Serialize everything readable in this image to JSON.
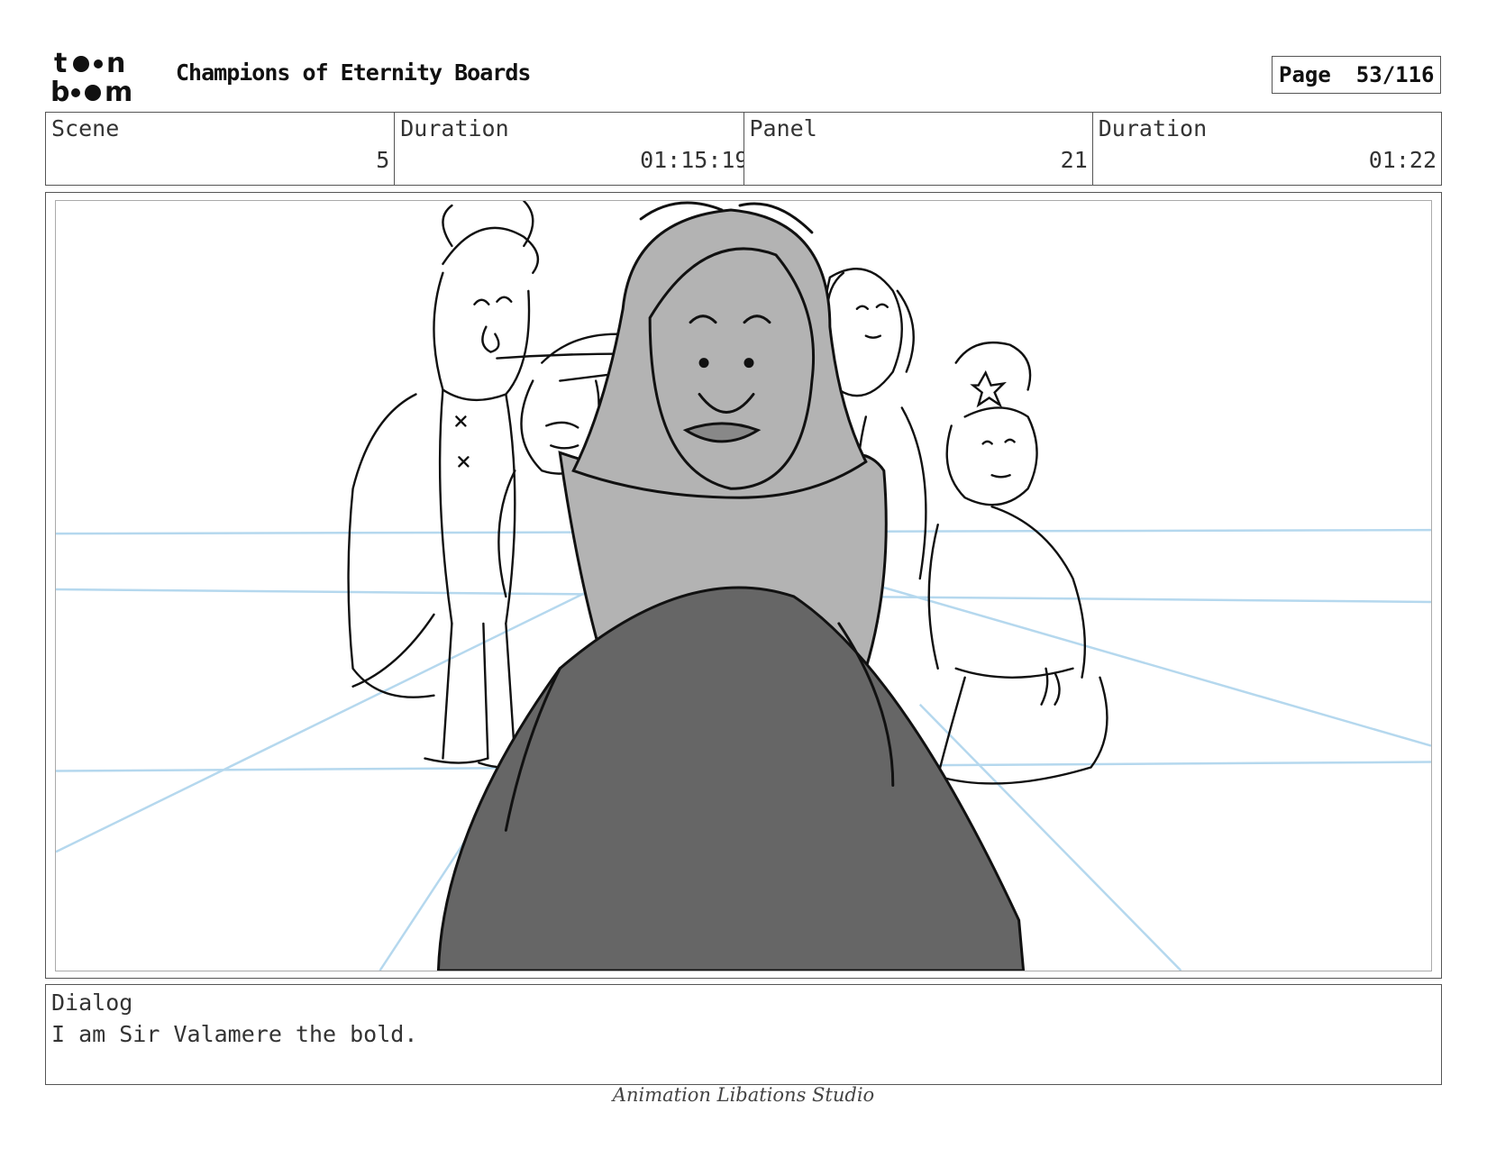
{
  "header": {
    "logo_text": "toon boom",
    "title": "Champions of Eternity Boards",
    "page_label": "Page",
    "page_value": "53/116"
  },
  "info": {
    "scene_label": "Scene",
    "scene_value": "5",
    "scene_duration_label": "Duration",
    "scene_duration_value": "01:15:19",
    "panel_label": "Panel",
    "panel_value": "21",
    "panel_duration_label": "Duration",
    "panel_duration_value": "01:22"
  },
  "dialog": {
    "label": "Dialog",
    "text": "I am Sir Valamere the bold."
  },
  "footer": {
    "studio": "Animation Libations Studio"
  },
  "colors": {
    "perspective_lines": "#b5d8ee",
    "foreground_tone": "#666666",
    "character_tone": "#b3b3b3"
  }
}
